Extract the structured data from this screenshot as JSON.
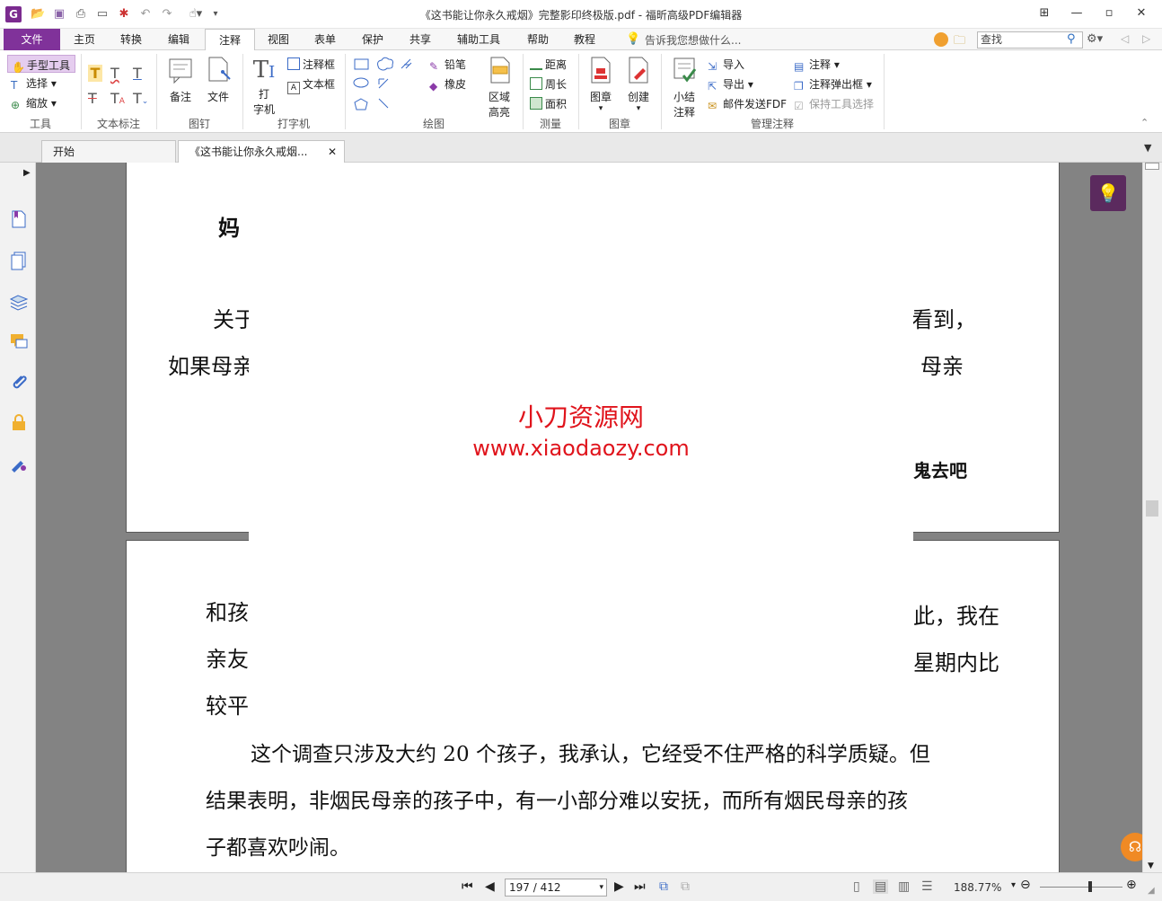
{
  "title": {
    "window_title": "《这书能让你永久戒烟》完整影印终极版.pdf - 福昕高级PDF编辑器",
    "app_icon_letter": "G"
  },
  "menu": {
    "tabs": [
      "文件",
      "主页",
      "转换",
      "编辑",
      "注释",
      "视图",
      "表单",
      "保护",
      "共享",
      "辅助工具",
      "帮助",
      "教程"
    ],
    "active_tab": "注释",
    "tell_me": "告诉我您想做什么...",
    "search_placeholder": "查找"
  },
  "ribbon": {
    "tools": {
      "hand": "手型工具",
      "select": "选择",
      "zoom": "缩放",
      "label": "工具"
    },
    "text_markup": {
      "label": "文本标注"
    },
    "pin": {
      "note": "备注",
      "file": "文件",
      "label": "图钉"
    },
    "typewriter": {
      "typewriter_line1": "打",
      "typewriter_line2": "字机",
      "callout": "注释框",
      "textbox": "文本框",
      "label": "打字机"
    },
    "drawing": {
      "pencil": "铅笔",
      "eraser": "橡皮",
      "area_line1": "区域",
      "area_line2": "高亮",
      "label": "绘图"
    },
    "measure": {
      "distance": "距离",
      "perimeter": "周长",
      "area": "面积",
      "label": "测量"
    },
    "stamp": {
      "stamp": "图章",
      "create": "创建",
      "label": "图章"
    },
    "manage": {
      "summary_line1": "小结",
      "summary_line2": "注释",
      "import": "导入",
      "export": "导出",
      "email": "邮件发送FDF",
      "comments": "注释",
      "popup": "注释弹出框",
      "keep_tool": "保持工具选择",
      "label": "管理注释"
    }
  },
  "doc_tabs": {
    "home": "开始",
    "current": "《这书能让你永久戒烟..."
  },
  "document": {
    "page1": {
      "heading_fragment": "妈",
      "line1_left": "关于",
      "line1_right": "看到，",
      "line2_left": "如果母亲",
      "line2_right": "母亲",
      "bold_right": "鬼去吧"
    },
    "page2": {
      "line1_left": "和孩",
      "line1_right": "此，我在",
      "line2_left": "亲友",
      "line2_right": "星期内比",
      "line3_left": "较平",
      "para_line1": "这个调查只涉及大约 20 个孩子，我承认，它经受不住严格的科学质疑。但",
      "para_line2": "结果表明，非烟民母亲的孩子中，有一小部分难以安抚，而所有烟民母亲的孩",
      "para_line3": "子都喜欢吵闹。"
    },
    "watermark": {
      "name": "小刀资源网",
      "url": "www.xiaodaozy.com"
    }
  },
  "status": {
    "page_display": "197 / 412",
    "zoom": "188.77%"
  },
  "colors": {
    "brand": "#80329a",
    "watermark": "#e0141c",
    "tip_button": "#5b2a5e",
    "help_button": "#f08a24"
  }
}
